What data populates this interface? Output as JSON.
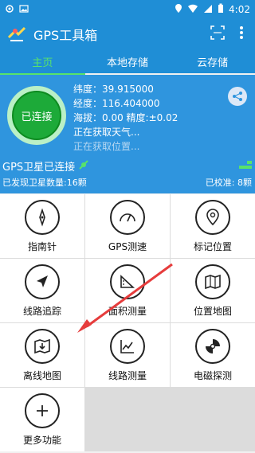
{
  "status_bar": {
    "time": "4:02",
    "left_icons": [
      "gps-location-icon",
      "image-icon"
    ],
    "right_icons": [
      "location-icon",
      "wifi-icon",
      "signal-icon",
      "battery-icon"
    ]
  },
  "app_bar": {
    "title": "GPS工具箱",
    "actions": [
      "scan-icon",
      "more-vert-icon"
    ]
  },
  "tabs": [
    {
      "label": "主页",
      "active": true
    },
    {
      "label": "本地存储",
      "active": false
    },
    {
      "label": "云存储",
      "active": false
    }
  ],
  "connection": {
    "button_label": "已连接"
  },
  "info": {
    "latitude": "纬度：39.915000",
    "longitude": "经度：116.404000",
    "altitude": "海拔：0.00   精度:±0.02",
    "weather": "正在获取天气...",
    "location": "正在获取位置..."
  },
  "gps": {
    "title": "GPS卫星已连接",
    "found": "已发现卫星数量:16颗",
    "calibrated": "已校准: 8颗"
  },
  "tools": [
    {
      "label": "指南针",
      "icon": "compass-icon"
    },
    {
      "label": "GPS测速",
      "icon": "speedometer-icon"
    },
    {
      "label": "标记位置",
      "icon": "map-marker-icon"
    },
    {
      "label": "线路追踪",
      "icon": "navigation-arrow-icon"
    },
    {
      "label": "面积测量",
      "icon": "area-ruler-icon"
    },
    {
      "label": "位置地图",
      "icon": "map-icon"
    },
    {
      "label": "离线地图",
      "icon": "offline-map-icon"
    },
    {
      "label": "线路测量",
      "icon": "line-chart-icon"
    },
    {
      "label": "电磁探测",
      "icon": "radar-icon"
    },
    {
      "label": "更多功能",
      "icon": "plus-icon"
    }
  ],
  "colors": {
    "primary": "#1f8ed6",
    "panel": "#2f95de",
    "connected": "#1daa39",
    "accent": "#58e36a"
  }
}
